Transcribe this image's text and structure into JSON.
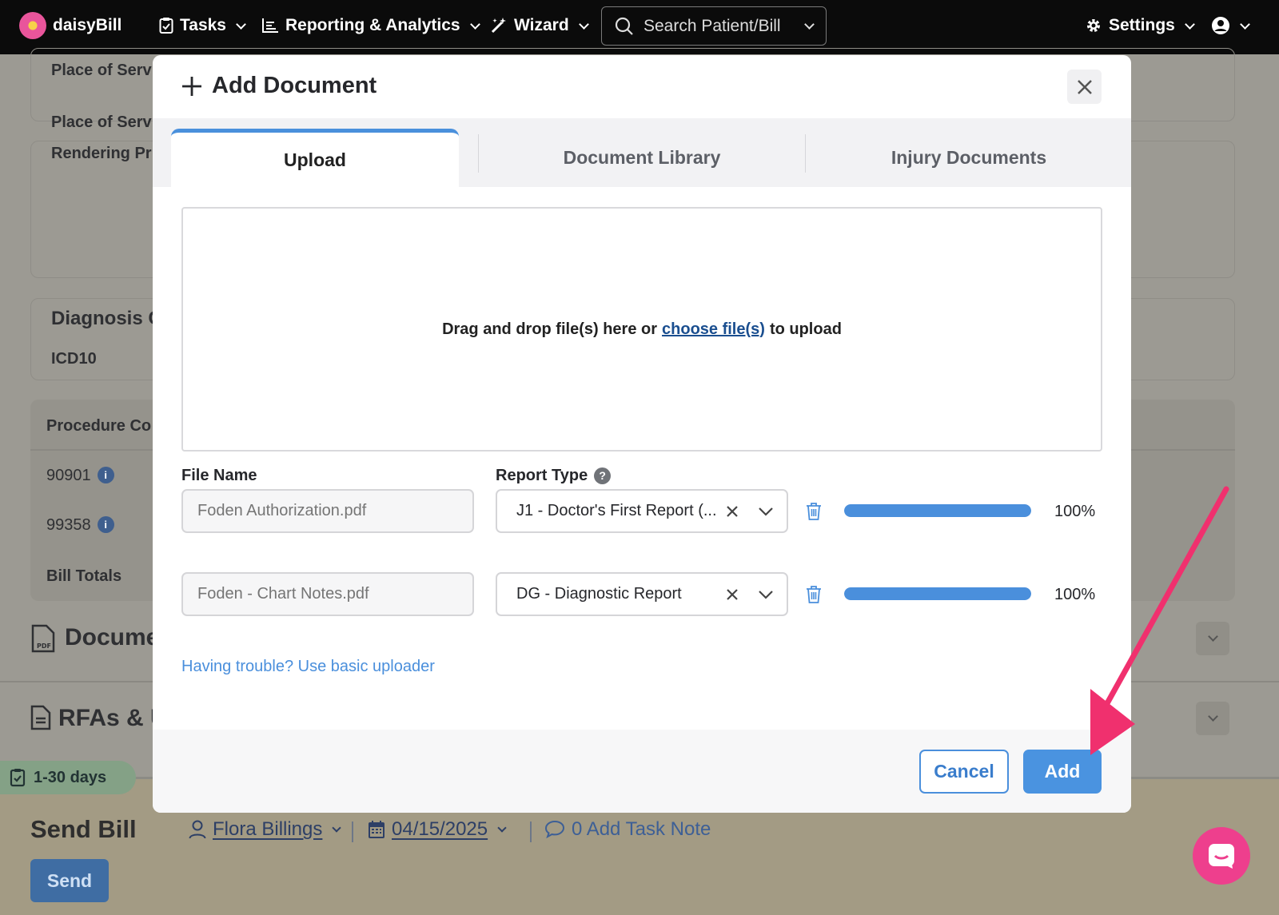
{
  "nav": {
    "logo_prefix": "daisy",
    "logo_suffix": "Bill",
    "tasks": "Tasks",
    "reporting": "Reporting & Analytics",
    "wizard": "Wizard",
    "search_placeholder": "Search Patient/Bill",
    "settings": "Settings"
  },
  "background": {
    "place_of_service_1": "Place of Servi",
    "place_of_service_2": "Place of Servi",
    "rendering": "Rendering Pr",
    "diagnosis": "Diagnosis C",
    "icd10": "ICD10",
    "procedure": "Procedure Co",
    "codes": [
      "90901",
      "99358"
    ],
    "bill_totals": "Bill Totals",
    "documents": "Docume",
    "rfas": "RFAs & U"
  },
  "bottom": {
    "days_badge": "1-30 days",
    "send_title": "Send Bill",
    "assignee": "Flora Billings",
    "date": "04/15/2025",
    "task_note": "0 Add Task Note",
    "send_button": "Send"
  },
  "modal": {
    "title": "Add Document",
    "tabs": [
      "Upload",
      "Document Library",
      "Injury Documents"
    ],
    "active_tab": "Upload",
    "dropzone_text_before": "Drag and drop file(s) here or",
    "dropzone_link": "choose file(s)",
    "dropzone_text_after": "to upload",
    "file_name_label": "File Name",
    "report_type_label": "Report Type",
    "files": [
      {
        "name": "Foden Authorization.pdf",
        "report_type": "J1 - Doctor's First Report (...",
        "progress_pct": "100%",
        "progress": 1.0
      },
      {
        "name": "Foden - Chart Notes.pdf",
        "report_type": "DG - Diagnostic Report",
        "progress_pct": "100%",
        "progress": 1.0
      }
    ],
    "trouble_link": "Having trouble? Use basic uploader",
    "cancel": "Cancel",
    "add": "Add"
  },
  "colors": {
    "accent": "#4a8fdc",
    "annotation_arrow": "#f0306e",
    "nav_bg": "#0b0b0b"
  },
  "icons": [
    "daisy-logo-icon",
    "tasks-icon",
    "chart-icon",
    "wand-icon",
    "search-icon",
    "gear-icon",
    "user-circle-icon",
    "plus-icon",
    "close-icon",
    "help-icon",
    "clear-icon",
    "chevron-down-icon",
    "trash-icon",
    "pdf-icon",
    "document-icon",
    "clipboard-icon",
    "user-icon",
    "calendar-icon",
    "comment-icon",
    "chat-icon"
  ]
}
